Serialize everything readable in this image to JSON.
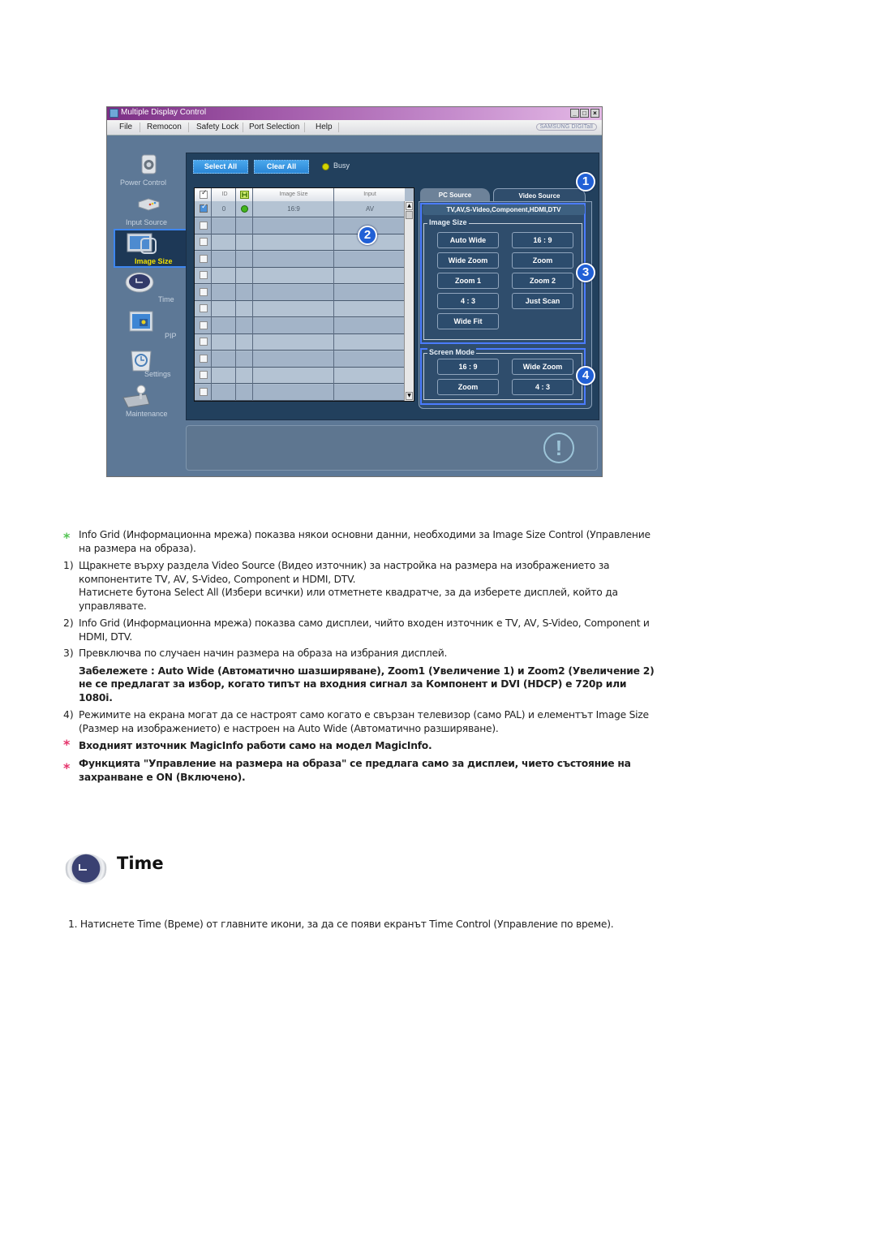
{
  "window": {
    "title": "Multiple Display Control",
    "controls": [
      "_",
      "□",
      "×"
    ],
    "brand": "SAMSUNG DIGITall"
  },
  "menu": [
    "File",
    "Remocon",
    "Safety Lock",
    "Port Selection",
    "Help"
  ],
  "sidebar": [
    {
      "label": "Power Control",
      "icon": "power-control-icon",
      "active": false
    },
    {
      "label": "Input Source",
      "icon": "input-source-icon",
      "active": false
    },
    {
      "label": "Image Size",
      "icon": "image-size-icon",
      "active": true
    },
    {
      "label": "Time",
      "icon": "time-icon",
      "active": false
    },
    {
      "label": "PIP",
      "icon": "pip-icon",
      "active": false
    },
    {
      "label": "Settings",
      "icon": "settings-icon",
      "active": false
    },
    {
      "label": "Maintenance",
      "icon": "maintenance-icon",
      "active": false
    }
  ],
  "toolbar": {
    "select_all": "Select All",
    "clear_all": "Clear All",
    "busy_label": "Busy"
  },
  "grid": {
    "columns": [
      "",
      "ID",
      "",
      "Image Size",
      "Input"
    ],
    "rows": [
      {
        "checked": true,
        "id": "0",
        "status": "on",
        "image_size": "16:9",
        "input": "AV"
      },
      {
        "checked": false,
        "id": "",
        "status": "",
        "image_size": "",
        "input": ""
      },
      {
        "checked": false,
        "id": "",
        "status": "",
        "image_size": "",
        "input": ""
      },
      {
        "checked": false,
        "id": "",
        "status": "",
        "image_size": "",
        "input": ""
      },
      {
        "checked": false,
        "id": "",
        "status": "",
        "image_size": "",
        "input": ""
      },
      {
        "checked": false,
        "id": "",
        "status": "",
        "image_size": "",
        "input": ""
      },
      {
        "checked": false,
        "id": "",
        "status": "",
        "image_size": "",
        "input": ""
      },
      {
        "checked": false,
        "id": "",
        "status": "",
        "image_size": "",
        "input": ""
      },
      {
        "checked": false,
        "id": "",
        "status": "",
        "image_size": "",
        "input": ""
      },
      {
        "checked": false,
        "id": "",
        "status": "",
        "image_size": "",
        "input": ""
      },
      {
        "checked": false,
        "id": "",
        "status": "",
        "image_size": "",
        "input": ""
      },
      {
        "checked": false,
        "id": "",
        "status": "",
        "image_size": "",
        "input": ""
      }
    ]
  },
  "tabs": {
    "pc_source": "PC Source",
    "video_source": "Video Source",
    "sources_strip": "TV,AV,S-Video,Component,HDMI,DTV"
  },
  "image_size": {
    "title": "Image Size",
    "options": [
      "Auto Wide",
      "16 : 9",
      "Wide Zoom",
      "Zoom",
      "Zoom 1",
      "Zoom 2",
      "4 : 3",
      "Just Scan",
      "Wide Fit"
    ]
  },
  "screen_mode": {
    "title": "Screen Mode",
    "options": [
      "16 : 9",
      "Wide Zoom",
      "Zoom",
      "4 : 3"
    ]
  },
  "callouts": [
    "1",
    "2",
    "3",
    "4"
  ],
  "doc": {
    "note_info_grid": "Info Grid (Информационна мрежа) показва някои основни данни, необходими за Image Size Control (Управление на размера на образа).",
    "items": [
      {
        "num": "1)",
        "text": "Щракнете върху раздела Video Source (Видео източник) за настройка на размера на изображението за компонентите TV, AV, S-Video, Component и HDMI, DTV.",
        "extra": "Натиснете бутона Select All (Избери всички) или отметнете квадратче, за да изберете дисплей, който да управлявате."
      },
      {
        "num": "2)",
        "text": "Info Grid (Информационна мрежа) показва само дисплеи, чийто входен източник е TV, AV, S-Video, Component и HDMI, DTV."
      },
      {
        "num": "3)",
        "text": "Превключва по случаен начин размера на образа на избрания дисплей.",
        "note": "Забележете : Auto Wide (Автоматично шазширяване), Zoom1 (Увеличение 1) и Zoom2 (Увеличение 2) не се предлагат за избор, когато типът на входния сигнал за Компонент и DVI (HDCP) е 720p или 1080i."
      },
      {
        "num": "4)",
        "text": "Режимите на екрана могат да се настроят само когато е свързан телевизор (само PAL) и елементът Image Size (Размер на изображението) е настроен на Auto Wide (Автоматично разширяване)."
      }
    ],
    "warning_1": "Входният източник MagicInfo работи само на модел MagicInfo.",
    "warning_2": "Функцията \"Управление на размера на образа\" се предлага само за дисплеи, чието състояние на захранване е ON (Включено).",
    "section_title": "Time",
    "section_step": "1.  Натиснете Time (Време) от главните икони, за да се появи екранът Time Control (Управление по време)."
  },
  "colors": {
    "star_green": "#52c452",
    "star_pink": "#e5336b",
    "callout_blue": "#2160d6",
    "highlight_blue": "#4b7cff",
    "active_label": "#f4e200"
  }
}
